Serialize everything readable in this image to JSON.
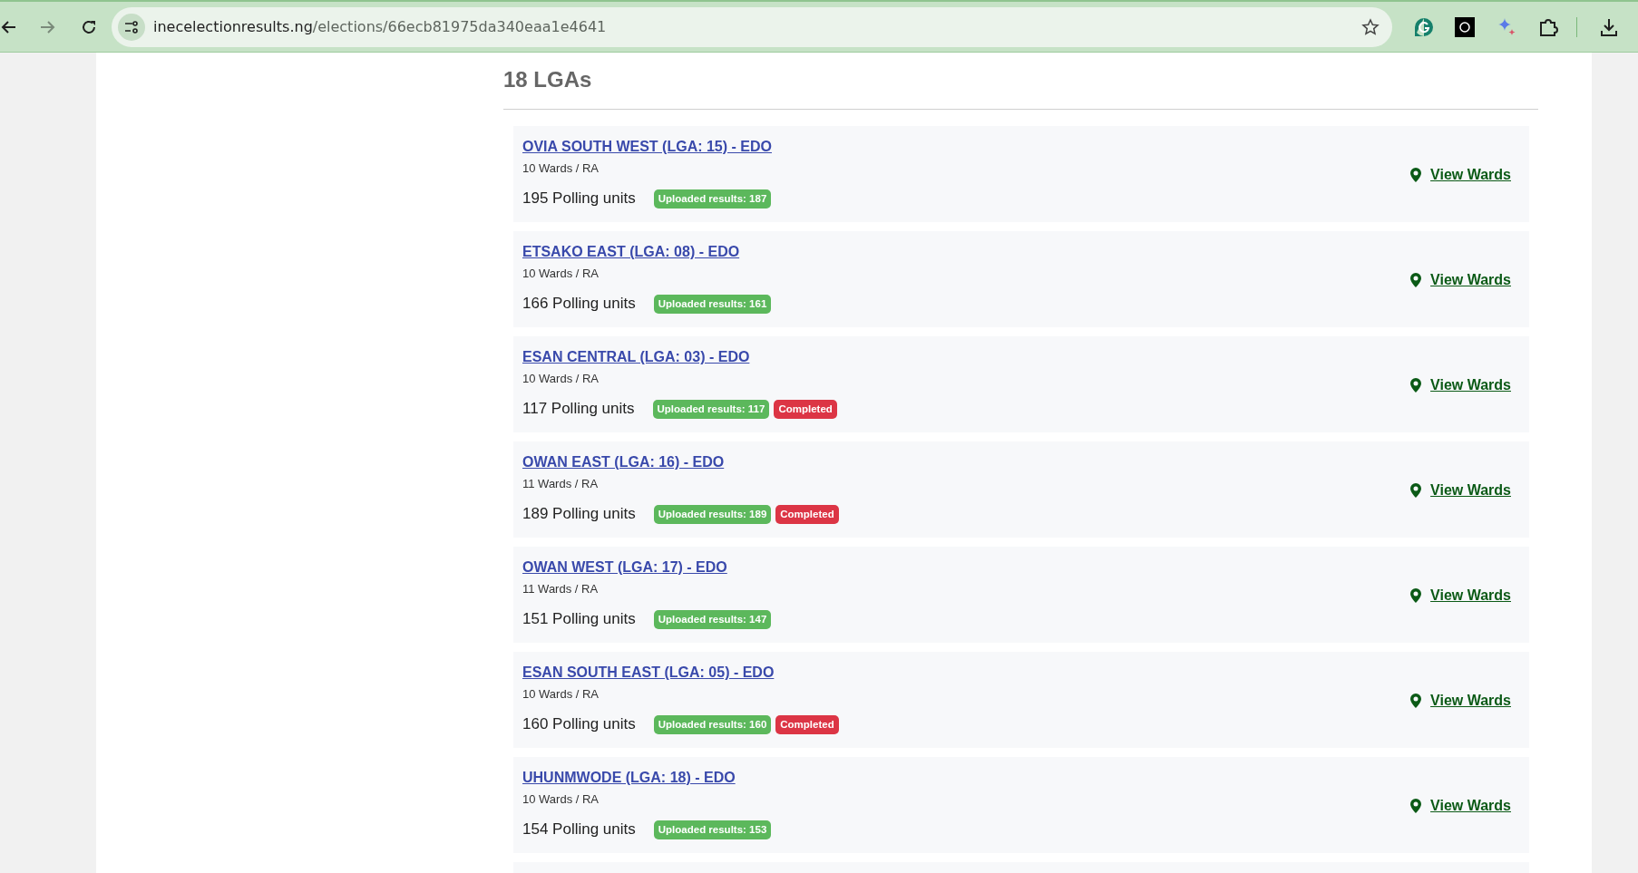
{
  "browser": {
    "url_host": "inecelectionresults.ng",
    "url_path": "/elections/66ecb81975da340eaa1e4641"
  },
  "heading": "18 LGAs",
  "lgas": [
    {
      "title": "OVIA SOUTH WEST (LGA: 15) - EDO",
      "wards": "10 Wards / RA",
      "polling": "195 Polling units",
      "badges": [
        {
          "kind": "uploaded",
          "text": "Uploaded results: 187"
        }
      ],
      "link": "View Wards"
    },
    {
      "title": "ETSAKO EAST (LGA: 08) - EDO",
      "wards": "10 Wards / RA",
      "polling": "166 Polling units",
      "badges": [
        {
          "kind": "uploaded",
          "text": "Uploaded results: 161"
        }
      ],
      "link": "View Wards"
    },
    {
      "title": "ESAN CENTRAL (LGA: 03) - EDO",
      "wards": "10 Wards / RA",
      "polling": "117 Polling units",
      "badges": [
        {
          "kind": "uploaded",
          "text": "Uploaded results: 117"
        },
        {
          "kind": "completed",
          "text": "Completed"
        }
      ],
      "link": "View Wards"
    },
    {
      "title": "OWAN EAST (LGA: 16) - EDO",
      "wards": "11 Wards / RA",
      "polling": "189 Polling units",
      "badges": [
        {
          "kind": "uploaded",
          "text": "Uploaded results: 189"
        },
        {
          "kind": "completed",
          "text": "Completed"
        }
      ],
      "link": "View Wards"
    },
    {
      "title": "OWAN WEST (LGA: 17) - EDO",
      "wards": "11 Wards / RA",
      "polling": "151 Polling units",
      "badges": [
        {
          "kind": "uploaded",
          "text": "Uploaded results: 147"
        }
      ],
      "link": "View Wards"
    },
    {
      "title": "ESAN SOUTH EAST (LGA: 05) - EDO",
      "wards": "10 Wards / RA",
      "polling": "160 Polling units",
      "badges": [
        {
          "kind": "uploaded",
          "text": "Uploaded results: 160"
        },
        {
          "kind": "completed",
          "text": "Completed"
        }
      ],
      "link": "View Wards"
    },
    {
      "title": "UHUNMWODE (LGA: 18) - EDO",
      "wards": "10 Wards / RA",
      "polling": "154 Polling units",
      "badges": [
        {
          "kind": "uploaded",
          "text": "Uploaded results: 153"
        }
      ],
      "link": "View Wards"
    }
  ]
}
